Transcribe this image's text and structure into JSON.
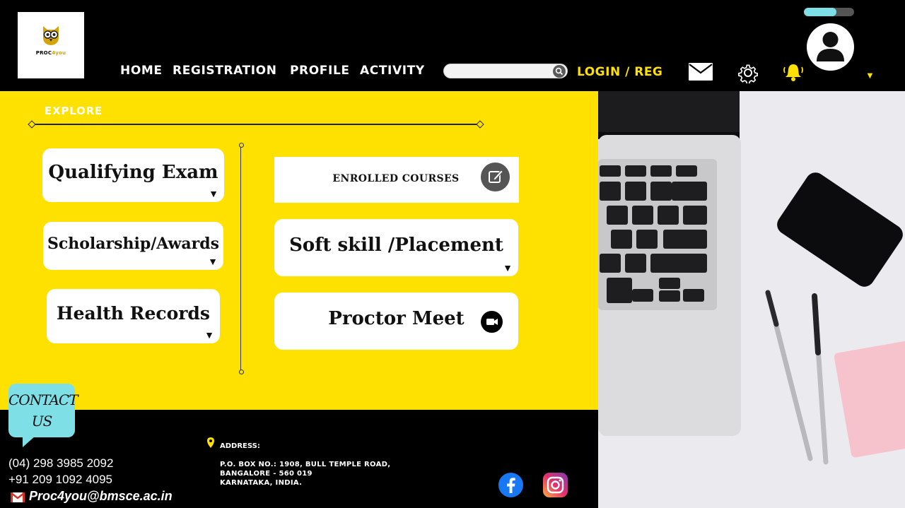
{
  "header": {
    "logo": {
      "brand_main": "PROC",
      "brand_accent": "4you"
    },
    "nav": [
      {
        "id": "home",
        "label": "HOME"
      },
      {
        "id": "registration",
        "label": "REGISTRATION"
      },
      {
        "id": "profile",
        "label": "PROFILE"
      },
      {
        "id": "activity",
        "label": "ACTIVITY"
      }
    ],
    "search": {
      "placeholder": "",
      "value": ""
    },
    "login_label": "LOGIN / REG",
    "progress_percent": 65,
    "icons": [
      "mail-icon",
      "gear-icon",
      "bell-icon",
      "user-avatar-icon",
      "caret-down-icon"
    ]
  },
  "explore": {
    "title": "EXPLORE",
    "left_cards": [
      {
        "label": "Qualifying Exam"
      },
      {
        "label": "Scholarship/Awards"
      },
      {
        "label": "Health Records"
      }
    ],
    "right_cards": {
      "enrolled": "ENROLLED COURSES",
      "softskill": "Soft skill /Placement",
      "proctor": "Proctor Meet"
    }
  },
  "footer": {
    "contact_line1": "CONTACT",
    "contact_line2": "US",
    "phone1": "(04) 298 3985 2092",
    "phone2": "+91 209 1092 4095",
    "email": "Proc4you@bmsce.ac.in",
    "address_title": "ADDRESS:",
    "address_lines": [
      "P.O. BOX NO.: 1908, BULL TEMPLE ROAD,",
      "BANGALORE - 560 019",
      "KARNATAKA, INDIA."
    ]
  },
  "colors": {
    "accent_yellow": "#ffe100",
    "background_black": "#000000",
    "contact_cyan": "#7fdfe6"
  }
}
